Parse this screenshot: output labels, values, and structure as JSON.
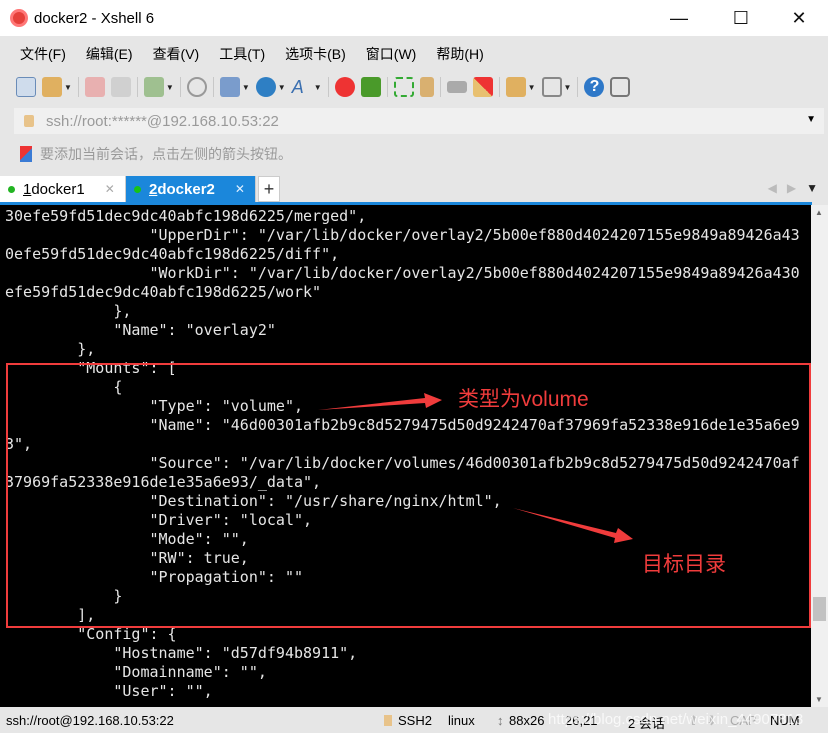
{
  "window": {
    "title": "docker2 - Xshell 6",
    "minimize": "—",
    "maximize": "☐",
    "close": "✕"
  },
  "menu": [
    "文件(F)",
    "编辑(E)",
    "查看(V)",
    "工具(T)",
    "选项卡(B)",
    "窗口(W)",
    "帮助(H)"
  ],
  "toolbar_icons": [
    "new-session-icon",
    "open-folder-icon",
    "disconnect-icon",
    "reconnect-icon",
    "properties-icon",
    "find-icon",
    "transfer-icon",
    "globe-icon",
    "font-icon",
    "xshell-icon",
    "xftp-icon",
    "fullscreen-icon",
    "lock-icon",
    "keyboard-icon",
    "highlight-icon",
    "new-tab-icon",
    "layout-icon",
    "help-icon",
    "chat-icon"
  ],
  "address": {
    "value": "ssh://root:******@192.168.10.53:22"
  },
  "hint": "要添加当前会话，点击左侧的箭头按钮。",
  "tabs": [
    {
      "num": "1",
      "label": " docker1",
      "active": false
    },
    {
      "num": "2",
      "label": " docker2",
      "active": true
    }
  ],
  "terminal": {
    "lines": [
      "30efe59fd51dec9dc40abfc198d6225/merged\",",
      "                \"UpperDir\": \"/var/lib/docker/overlay2/5b00ef880d4024207155e9849a89426a43",
      "0efe59fd51dec9dc40abfc198d6225/diff\",",
      "                \"WorkDir\": \"/var/lib/docker/overlay2/5b00ef880d4024207155e9849a89426a430",
      "efe59fd51dec9dc40abfc198d6225/work\"",
      "            },",
      "            \"Name\": \"overlay2\"",
      "        },",
      "        \"Mounts\": [",
      "            {",
      "                \"Type\": \"volume\",",
      "                \"Name\": \"46d00301afb2b9c8d5279475d50d9242470af37969fa52338e916de1e35a6e9",
      "3\",",
      "                \"Source\": \"/var/lib/docker/volumes/46d00301afb2b9c8d5279475d50d9242470af",
      "37969fa52338e916de1e35a6e93/_data\",",
      "                \"Destination\": \"/usr/share/nginx/html\",",
      "                \"Driver\": \"local\",",
      "                \"Mode\": \"\",",
      "                \"RW\": true,",
      "                \"Propagation\": \"\"",
      "            }",
      "        ],",
      "        \"Config\": {",
      "            \"Hostname\": \"d57df94b8911\",",
      "            \"Domainname\": \"\",",
      "            \"User\": \"\","
    ]
  },
  "annotations": {
    "type_note": "类型为volume",
    "dest_note": "目标目录",
    "color": "#f03c3c"
  },
  "status": {
    "connection": "ssh://root@192.168.10.53:22",
    "protocol": "SSH2",
    "os": "linux",
    "size": "88x26",
    "cursor": "26,21",
    "sessions": "2 会话",
    "cap": "CAP",
    "num": "NUM",
    "watermark": "https://blog.csdn.net/weixin_44907813"
  }
}
